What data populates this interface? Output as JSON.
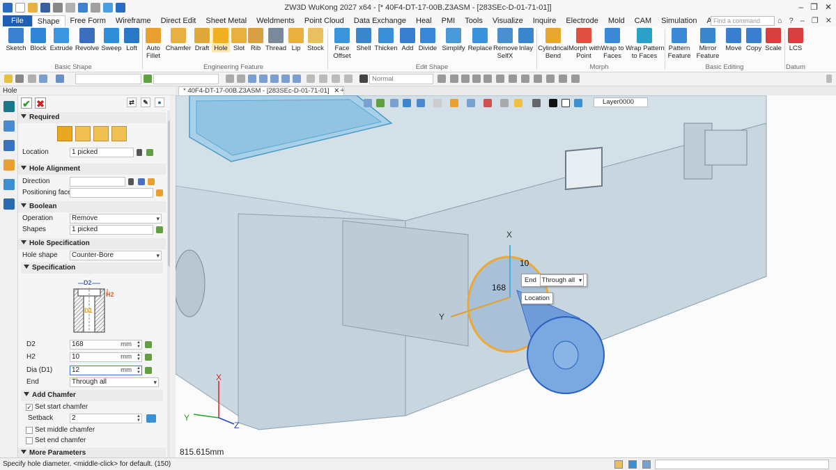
{
  "titlebar": {
    "title": "ZW3D WuKong 2027  x64  - [* 40F4-DT-17-00B.Z3ASM - [283SEc-D-01-71-01]]",
    "controls": [
      "–",
      "❐",
      "✕"
    ]
  },
  "menu": {
    "items": [
      "File",
      "Shape",
      "Free Form",
      "Wireframe",
      "Direct Edit",
      "Sheet Metal",
      "Weldments",
      "Point Cloud",
      "Data Exchange",
      "Heal",
      "PMI",
      "Tools",
      "Visualize",
      "Inquire",
      "Electrode",
      "Mold",
      "CAM",
      "Simulation",
      "App"
    ],
    "active": "Shape",
    "search_placeholder": "Find a command",
    "right_icons": [
      "⌂",
      "?",
      "–",
      "❐",
      "✕"
    ]
  },
  "ribbon": {
    "basic_shape": {
      "label": "Basic Shape",
      "buttons": [
        "Sketch",
        "Block",
        "Extrude",
        "Revolve",
        "Sweep",
        "Loft"
      ]
    },
    "engineering_feature": {
      "label": "Engineering Feature",
      "buttons": [
        "Auto\nFillet",
        "Chamfer",
        "Draft",
        "Hole",
        "Slot",
        "Rib",
        "Thread",
        "Lip",
        "Stock"
      ]
    },
    "edit_shape": {
      "label": "Edit Shape",
      "buttons": [
        "Face\nOffset",
        "Shell",
        "Thicken",
        "Add",
        "Divide",
        "Simplify",
        "Replace",
        "Remove\nSelfX",
        "Inlay"
      ]
    },
    "morph": {
      "label": "Morph",
      "buttons": [
        "Cylindrical\nBend",
        "Morph with\nPoint",
        "Wrap to\nFaces",
        "Wrap Pattern\nto Faces"
      ]
    },
    "basic_editing": {
      "label": "Basic Editing",
      "buttons": [
        "Pattern\nFeature",
        "Mirror\nFeature",
        "Move",
        "Copy",
        "Scale"
      ]
    },
    "datum": {
      "label": "Datum",
      "buttons": [
        "LCS"
      ]
    }
  },
  "toolbar2": {
    "render_mode": "Normal"
  },
  "panel": {
    "title": "Hole",
    "sections": {
      "required": "Required",
      "hole_alignment": "Hole Alignment",
      "boolean": "Boolean",
      "hole_spec": "Hole Specification",
      "specification": "Specification",
      "add_chamfer": "Add Chamfer",
      "more_params": "More Parameters"
    },
    "location_label": "Location",
    "location_value": "1 picked",
    "direction_label": "Direction",
    "direction_value": "",
    "positioning_face_label": "Positioning face",
    "positioning_face_value": "",
    "operation_label": "Operation",
    "operation_value": "Remove",
    "shapes_label": "Shapes",
    "shapes_value": "1 picked",
    "hole_shape_label": "Hole shape",
    "hole_shape_value": "Counter-Bore",
    "diagram": {
      "d2": "D2",
      "h2": "H2",
      "d1": "D1"
    },
    "d2_label": "D2",
    "d2_value": "168",
    "h2_label": "H2",
    "h2_value": "10",
    "d1_label": "Dia (D1)",
    "d1_value": "12",
    "unit": "mm",
    "end_label": "End",
    "end_value": "Through all",
    "set_start_chamfer": "Set start chamfer",
    "set_start_chamfer_checked": true,
    "setback_label": "Setback",
    "setback_value": "2",
    "set_middle_chamfer": "Set middle chamfer",
    "set_middle_chamfer_checked": false,
    "set_end_chamfer": "Set end chamfer",
    "set_end_chamfer_checked": false
  },
  "doc_tab": {
    "label": "* 40F4-DT-17-00B.Z3ASM - [283SEc-D-01-71-01]",
    "close": "✕",
    "add": "+"
  },
  "viewport": {
    "layer": "Layer0000",
    "dim_10": "10",
    "dim_168": "168",
    "popup_end_label": "End",
    "popup_end_value": "Through all",
    "popup_location": "Location",
    "axis_hole_x": "X",
    "axis_hole_y": "Y",
    "axis_x": "X",
    "axis_y": "Y",
    "axis_z": "Z",
    "measure": "815.615mm"
  },
  "statusbar": {
    "message": "Specify hole diameter.   <middle-click> for default. (150)"
  },
  "colors": {
    "file_tab": "#1f5fb3",
    "model_fill": "#c6d6e2",
    "selection_blue": "#5b8fd6",
    "highlight_orange": "#f0a830",
    "axis_x": "#e02020",
    "axis_y": "#20a020",
    "axis_z": "#2040d0"
  }
}
